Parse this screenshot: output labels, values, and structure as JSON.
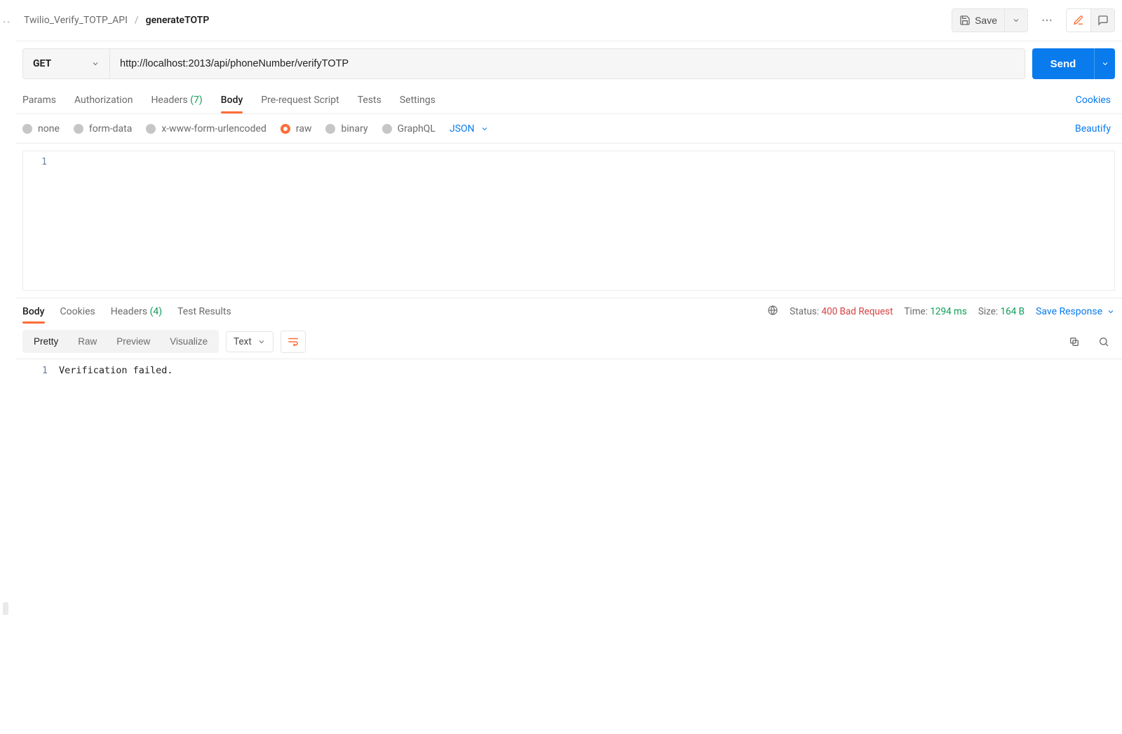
{
  "breadcrumb": {
    "collection": "Twilio_Verify_TOTP_API",
    "request": "generateTOTP"
  },
  "header": {
    "save": "Save"
  },
  "request": {
    "method": "GET",
    "url": "http://localhost:2013/api/phoneNumber/verifyTOTP",
    "send": "Send"
  },
  "tabs": {
    "params": "Params",
    "authorization": "Authorization",
    "headers": "Headers",
    "headers_count": "(7)",
    "body": "Body",
    "prerequest": "Pre-request Script",
    "tests": "Tests",
    "settings": "Settings",
    "cookies_link": "Cookies"
  },
  "body_types": {
    "none": "none",
    "form_data": "form-data",
    "x_www": "x-www-form-urlencoded",
    "raw": "raw",
    "binary": "binary",
    "graphql": "GraphQL",
    "format": "JSON",
    "beautify": "Beautify"
  },
  "request_editor": {
    "line1_num": "1",
    "line1_text": ""
  },
  "response_tabs": {
    "body": "Body",
    "cookies": "Cookies",
    "headers": "Headers",
    "headers_count": "(4)",
    "test_results": "Test Results"
  },
  "status": {
    "status_label": "Status:",
    "status_value": "400 Bad Request",
    "time_label": "Time:",
    "time_value": "1294 ms",
    "size_label": "Size:",
    "size_value": "164 B",
    "save_response": "Save Response"
  },
  "view_modes": {
    "pretty": "Pretty",
    "raw": "Raw",
    "preview": "Preview",
    "visualize": "Visualize",
    "lang": "Text"
  },
  "response_editor": {
    "line1_num": "1",
    "line1_text": "Verification failed."
  }
}
